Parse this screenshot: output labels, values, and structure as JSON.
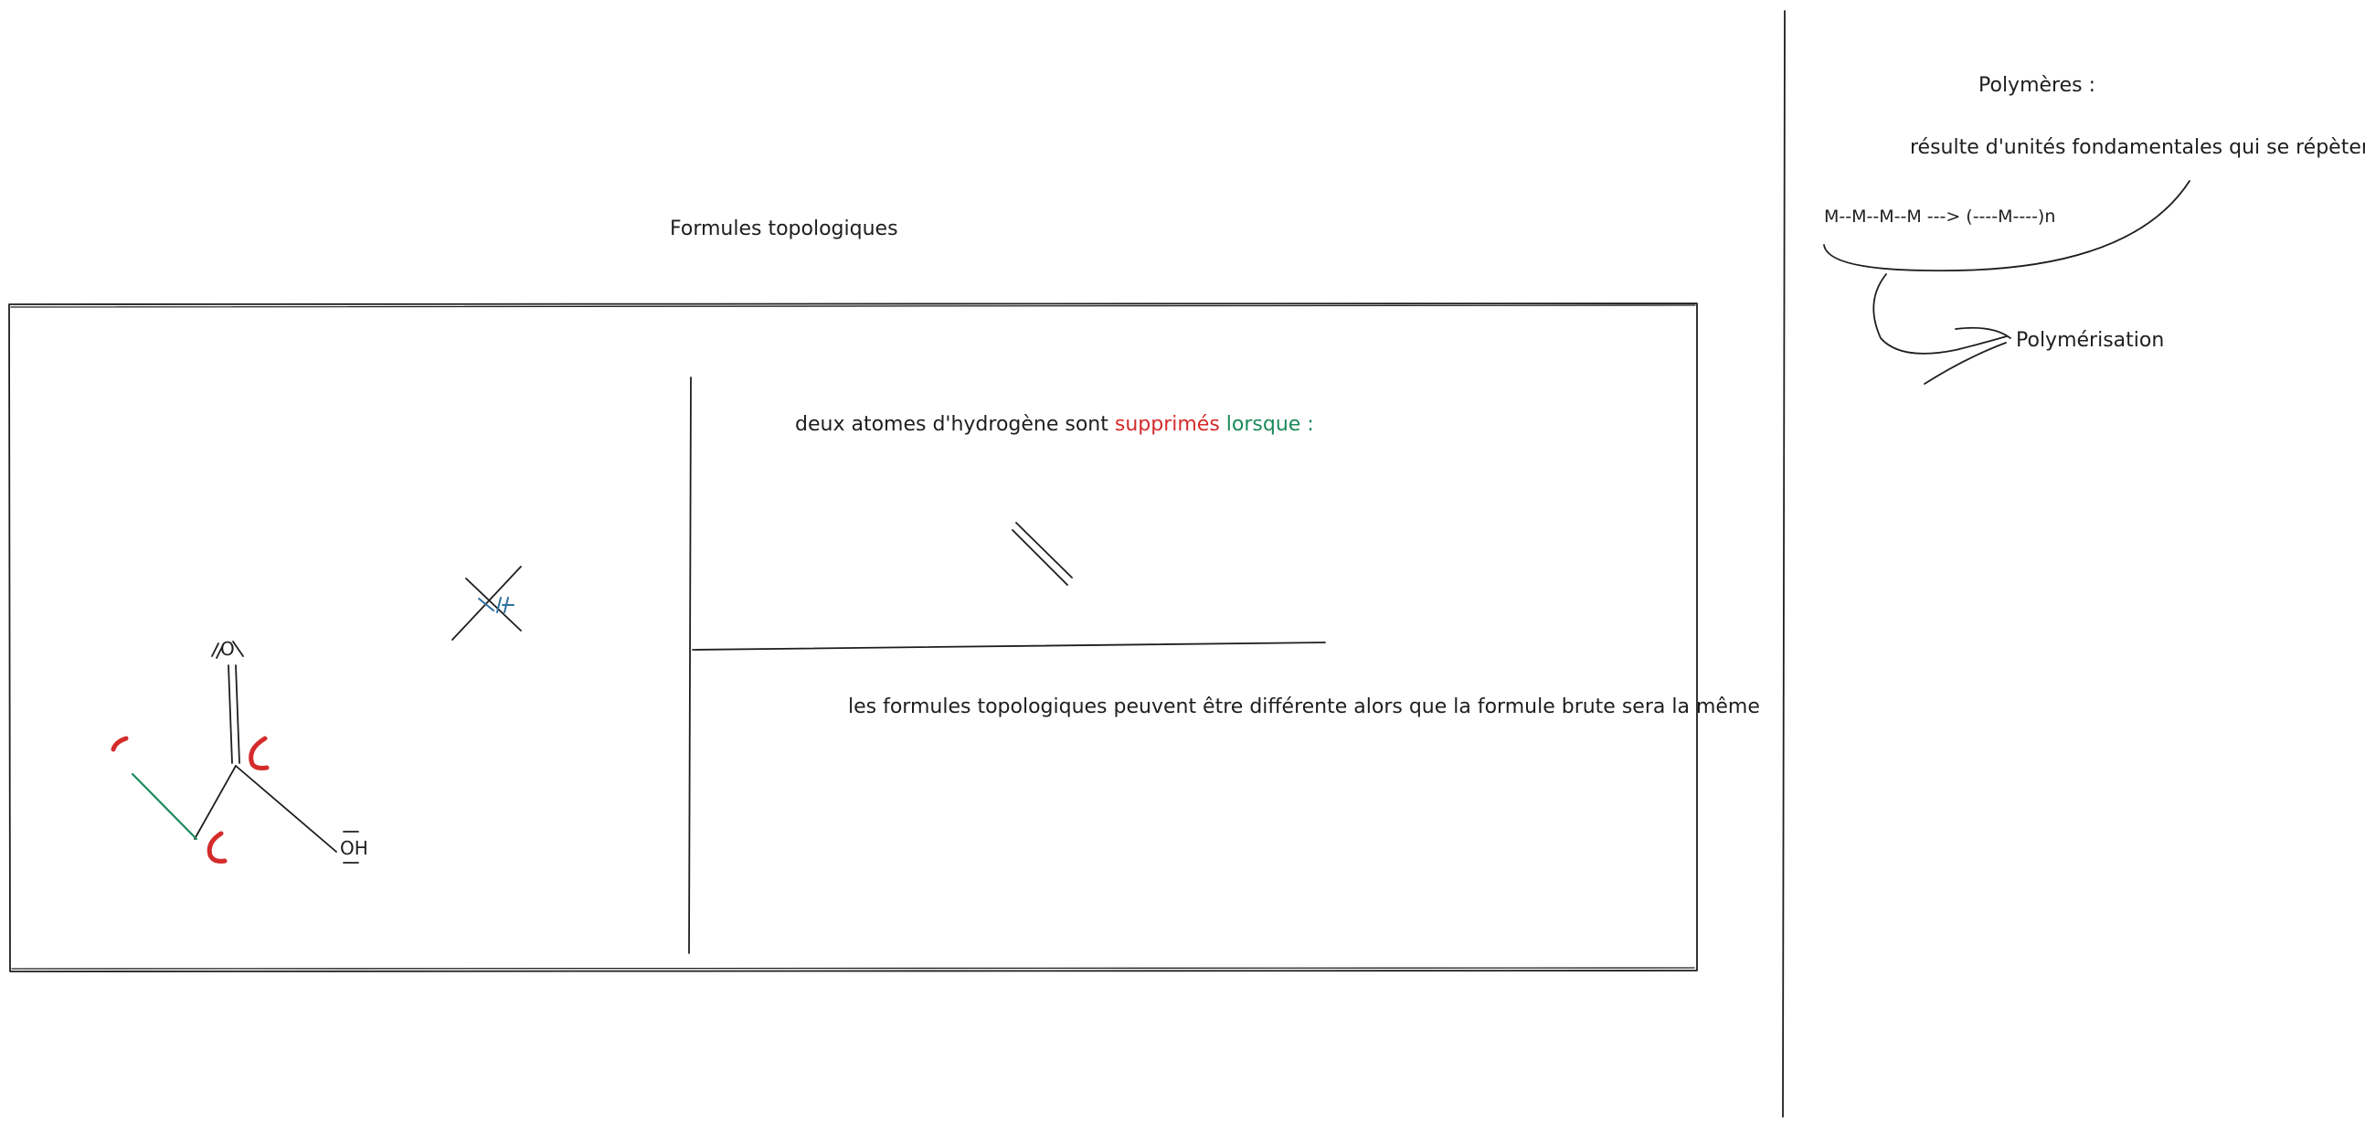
{
  "left_board": {
    "title": "Formules topologiques",
    "hydrogen_note": {
      "prefix": "deux atomes d'hydrogène sont ",
      "word_red": "supprimés",
      "space": " ",
      "word_green": "lorsque",
      "suffix": " :"
    },
    "bottom_note": "les formules topologiques peuvent être différente alors que la formule brute sera la même",
    "molecule": {
      "oxygen_label": "O",
      "hydroxyl_label": "OH"
    },
    "crossed_label": "H"
  },
  "right_board": {
    "title": "Polymères :",
    "definition": "résulte d'unités fondamentales qui se répètent :",
    "chain": "M--M--M--M  ---> (----M----)n",
    "process_label": "Polymérisation"
  },
  "colors": {
    "ink": "#1e1e1e",
    "red": "#d42b2b",
    "green": "#1b8a5a",
    "blue": "#2f6f9f"
  }
}
